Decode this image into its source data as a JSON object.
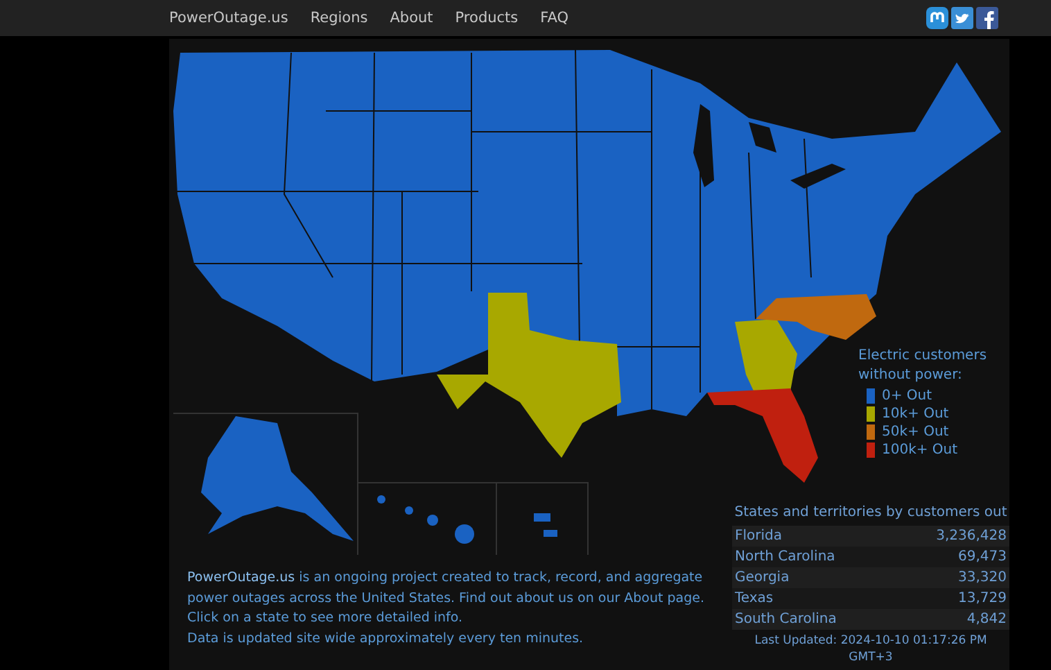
{
  "nav": {
    "brand": "PowerOutage.us",
    "links": [
      "Regions",
      "About",
      "Products",
      "FAQ"
    ]
  },
  "legend": {
    "title": "Electric customers without power:",
    "items": [
      {
        "label": "0+ Out",
        "color": "#1a62c2"
      },
      {
        "label": "10k+ Out",
        "color": "#a8a800"
      },
      {
        "label": "50k+ Out",
        "color": "#c0690f"
      },
      {
        "label": "100k+ Out",
        "color": "#c0200f"
      }
    ]
  },
  "table": {
    "title": "States and territories by customers out",
    "rows": [
      {
        "state": "Florida",
        "customers_out": "3,236,428"
      },
      {
        "state": "North Carolina",
        "customers_out": "69,473"
      },
      {
        "state": "Georgia",
        "customers_out": "33,320"
      },
      {
        "state": "Texas",
        "customers_out": "13,729"
      },
      {
        "state": "South Carolina",
        "customers_out": "4,842"
      }
    ],
    "last_updated": "Last Updated: 2024-10-10 01:17:26 PM GMT+3"
  },
  "intro": {
    "link": "PowerOutage.us",
    "text": " is an ongoing project created to track, record, and aggregate power outages across the United States. Find out about us on our About page.",
    "lines": [
      "Click on a state to see more detailed info.",
      "Data is updated site wide approximately every ten minutes."
    ]
  }
}
